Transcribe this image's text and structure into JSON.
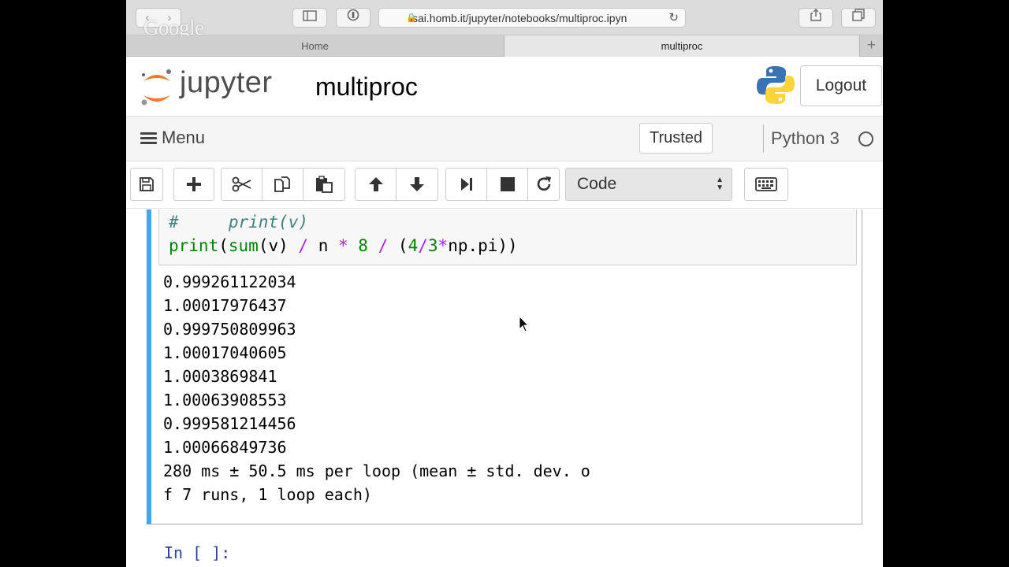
{
  "browser": {
    "url": "sai.homb.it/jupyter/notebooks/multiproc.ipyn",
    "watermark": "Google",
    "tabs": [
      {
        "label": "Home"
      },
      {
        "label": "multiproc"
      }
    ],
    "new_tab": "+"
  },
  "header": {
    "logo_text": "jupyter",
    "notebook_name": "multiproc",
    "logout_label": "Logout"
  },
  "menubar": {
    "menu_label": "Menu",
    "trusted_label": "Trusted",
    "kernel_name": "Python 3"
  },
  "toolbar": {
    "cell_type": "Code"
  },
  "cell": {
    "code_line1_comment": "#     print(v)",
    "code_line2": {
      "fn": "print",
      "p1": "(",
      "fn2": "sum",
      "p2": "(v) ",
      "op1": "/",
      "p3": " n ",
      "op2": "*",
      "p4": " ",
      "n1": "8",
      "p5": " ",
      "op3": "/",
      "p6": " (",
      "n2": "4",
      "op4": "/",
      "n3": "3",
      "op5": "*",
      "p7": "np.pi))"
    },
    "output_lines": [
      "0.999261122034",
      "1.00017976437",
      "0.999750809963",
      "1.00017040605",
      "1.0003869841",
      "1.00063908553",
      "0.999581214456",
      "1.00066849736",
      "280 ms ± 50.5 ms per loop (mean ± std. dev. o",
      "f 7 runs, 1 loop each)"
    ]
  },
  "next_cell": {
    "prompt": "In [ ]:"
  },
  "colors": {
    "selected_cell_border": "#42a5f5",
    "toolbar_bg": "#f5f5f5"
  },
  "icons": [
    "save-icon",
    "plus-icon",
    "cut-icon",
    "copy-icon",
    "paste-icon",
    "arrow-up-icon",
    "arrow-down-icon",
    "run-icon",
    "stop-icon",
    "restart-icon",
    "keyboard-icon",
    "lock-icon",
    "reload-icon",
    "share-icon",
    "tabs-icon",
    "sidebar-icon",
    "reader-icon"
  ]
}
